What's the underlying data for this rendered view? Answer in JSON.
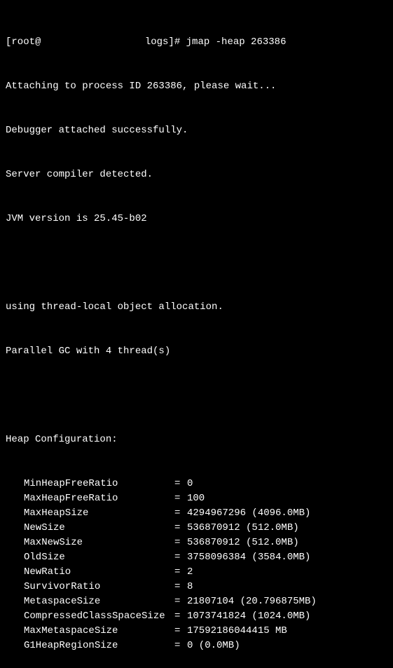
{
  "prompt": {
    "user_host_prefix": "[root@",
    "redacted_host": "",
    "cwd_suffix": " logs]#",
    "command": "jmap -heap 263386"
  },
  "messages": {
    "attaching": "Attaching to process ID 263386, please wait...",
    "debugger": "Debugger attached successfully.",
    "compiler": "Server compiler detected.",
    "jvm_version": "JVM version is 25.45-b02",
    "allocation": "using thread-local object allocation.",
    "gc_info": "Parallel GC with 4 thread(s)"
  },
  "heap_config": {
    "header": "Heap Configuration:",
    "rows": [
      {
        "key": "MinHeapFreeRatio",
        "value": "0"
      },
      {
        "key": "MaxHeapFreeRatio",
        "value": "100"
      },
      {
        "key": "MaxHeapSize",
        "value": "4294967296 (4096.0MB)"
      },
      {
        "key": "NewSize",
        "value": "536870912 (512.0MB)"
      },
      {
        "key": "MaxNewSize",
        "value": "536870912 (512.0MB)"
      },
      {
        "key": "OldSize",
        "value": "3758096384 (3584.0MB)"
      },
      {
        "key": "NewRatio",
        "value": "2"
      },
      {
        "key": "SurvivorRatio",
        "value": "8"
      },
      {
        "key": "MetaspaceSize",
        "value": "21807104 (20.796875MB)"
      },
      {
        "key": "CompressedClassSpaceSize",
        "value": "1073741824 (1024.0MB)"
      },
      {
        "key": "MaxMetaspaceSize",
        "value": "17592186044415 MB"
      },
      {
        "key": "G1HeapRegionSize",
        "value": "0 (0.0MB)"
      }
    ]
  }
}
